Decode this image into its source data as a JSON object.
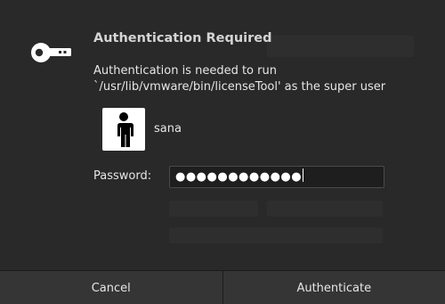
{
  "dialog": {
    "title": "Authentication Required",
    "message": "Authentication is needed to run `/usr/lib/vmware/bin/licenseTool' as the super user",
    "icon": "key-icon"
  },
  "user": {
    "name": "sana",
    "avatar_icon": "person-icon"
  },
  "password": {
    "label": "Password:",
    "masked_value": "●●●●●●●●●●●●"
  },
  "buttons": {
    "cancel": "Cancel",
    "authenticate": "Authenticate"
  },
  "colors": {
    "background": "#292929",
    "text": "#e6e6e6",
    "button": "#353535"
  }
}
